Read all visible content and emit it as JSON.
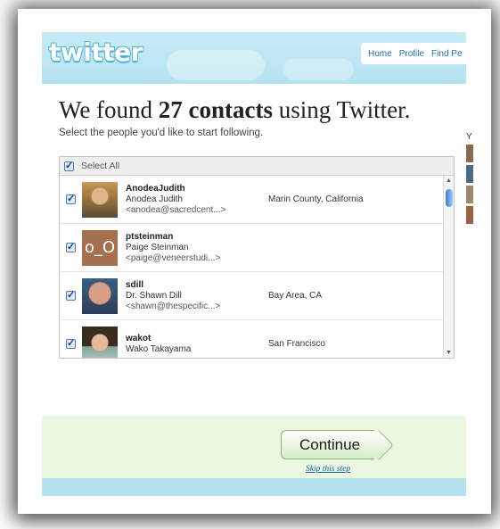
{
  "header": {
    "logo_text": "twitter",
    "nav": [
      "Home",
      "Profile",
      "Find Pe"
    ]
  },
  "main": {
    "title_prefix": "We found ",
    "title_bold": "27 contacts",
    "title_suffix": " using Twitter.",
    "subtitle": "Select the people you'd like to start following."
  },
  "contacts": {
    "select_all_label": "Select All",
    "select_all_checked": true,
    "rows": [
      {
        "username": "AnodeaJudith",
        "fullname": "Anodea Judith",
        "email": "<anodea@sacredcent...>",
        "location": "Marin County, California",
        "checked": true
      },
      {
        "username": "ptsteinman",
        "fullname": "Paige Steinman",
        "email": "<paige@veneerstudi...>",
        "location": "",
        "avatar_text": "o_O",
        "checked": true
      },
      {
        "username": "sdill",
        "fullname": "Dr. Shawn Dill",
        "email": "<shawn@thespecific...>",
        "location": "Bay Area, CA",
        "checked": true
      },
      {
        "username": "wakot",
        "fullname": "Wako Takayama",
        "email": "",
        "location": "San Francisco",
        "checked": true
      }
    ]
  },
  "actions": {
    "continue_label": "Continue",
    "skip_label": "Skip this step"
  },
  "sidebar_peek": {
    "letter": "Y"
  },
  "colors": {
    "header_bg": "#c6ebf5",
    "link": "#1a6fa8",
    "bottom_bg": "#e9f8df",
    "button_border": "#8ab47a"
  }
}
